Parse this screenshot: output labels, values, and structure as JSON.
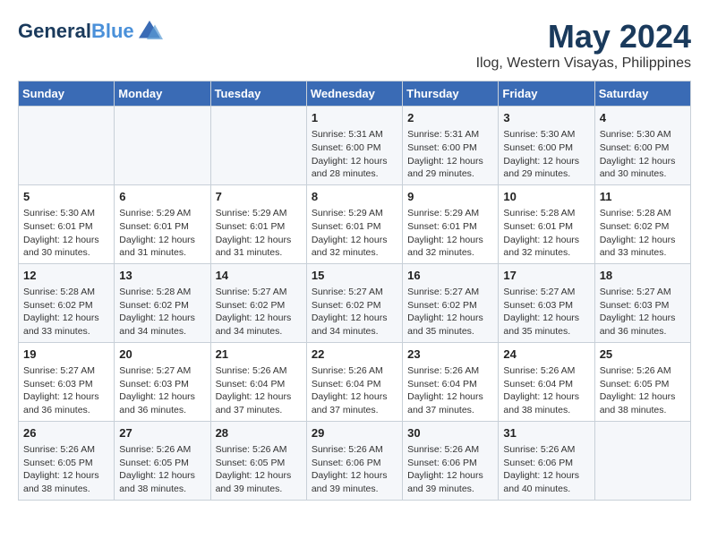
{
  "header": {
    "logo_line1": "General",
    "logo_line2": "Blue",
    "title": "May 2024",
    "subtitle": "Ilog, Western Visayas, Philippines"
  },
  "calendar": {
    "days_of_week": [
      "Sunday",
      "Monday",
      "Tuesday",
      "Wednesday",
      "Thursday",
      "Friday",
      "Saturday"
    ],
    "weeks": [
      [
        {
          "day": "",
          "info": ""
        },
        {
          "day": "",
          "info": ""
        },
        {
          "day": "",
          "info": ""
        },
        {
          "day": "1",
          "info": "Sunrise: 5:31 AM\nSunset: 6:00 PM\nDaylight: 12 hours\nand 28 minutes."
        },
        {
          "day": "2",
          "info": "Sunrise: 5:31 AM\nSunset: 6:00 PM\nDaylight: 12 hours\nand 29 minutes."
        },
        {
          "day": "3",
          "info": "Sunrise: 5:30 AM\nSunset: 6:00 PM\nDaylight: 12 hours\nand 29 minutes."
        },
        {
          "day": "4",
          "info": "Sunrise: 5:30 AM\nSunset: 6:00 PM\nDaylight: 12 hours\nand 30 minutes."
        }
      ],
      [
        {
          "day": "5",
          "info": "Sunrise: 5:30 AM\nSunset: 6:01 PM\nDaylight: 12 hours\nand 30 minutes."
        },
        {
          "day": "6",
          "info": "Sunrise: 5:29 AM\nSunset: 6:01 PM\nDaylight: 12 hours\nand 31 minutes."
        },
        {
          "day": "7",
          "info": "Sunrise: 5:29 AM\nSunset: 6:01 PM\nDaylight: 12 hours\nand 31 minutes."
        },
        {
          "day": "8",
          "info": "Sunrise: 5:29 AM\nSunset: 6:01 PM\nDaylight: 12 hours\nand 32 minutes."
        },
        {
          "day": "9",
          "info": "Sunrise: 5:29 AM\nSunset: 6:01 PM\nDaylight: 12 hours\nand 32 minutes."
        },
        {
          "day": "10",
          "info": "Sunrise: 5:28 AM\nSunset: 6:01 PM\nDaylight: 12 hours\nand 32 minutes."
        },
        {
          "day": "11",
          "info": "Sunrise: 5:28 AM\nSunset: 6:02 PM\nDaylight: 12 hours\nand 33 minutes."
        }
      ],
      [
        {
          "day": "12",
          "info": "Sunrise: 5:28 AM\nSunset: 6:02 PM\nDaylight: 12 hours\nand 33 minutes."
        },
        {
          "day": "13",
          "info": "Sunrise: 5:28 AM\nSunset: 6:02 PM\nDaylight: 12 hours\nand 34 minutes."
        },
        {
          "day": "14",
          "info": "Sunrise: 5:27 AM\nSunset: 6:02 PM\nDaylight: 12 hours\nand 34 minutes."
        },
        {
          "day": "15",
          "info": "Sunrise: 5:27 AM\nSunset: 6:02 PM\nDaylight: 12 hours\nand 34 minutes."
        },
        {
          "day": "16",
          "info": "Sunrise: 5:27 AM\nSunset: 6:02 PM\nDaylight: 12 hours\nand 35 minutes."
        },
        {
          "day": "17",
          "info": "Sunrise: 5:27 AM\nSunset: 6:03 PM\nDaylight: 12 hours\nand 35 minutes."
        },
        {
          "day": "18",
          "info": "Sunrise: 5:27 AM\nSunset: 6:03 PM\nDaylight: 12 hours\nand 36 minutes."
        }
      ],
      [
        {
          "day": "19",
          "info": "Sunrise: 5:27 AM\nSunset: 6:03 PM\nDaylight: 12 hours\nand 36 minutes."
        },
        {
          "day": "20",
          "info": "Sunrise: 5:27 AM\nSunset: 6:03 PM\nDaylight: 12 hours\nand 36 minutes."
        },
        {
          "day": "21",
          "info": "Sunrise: 5:26 AM\nSunset: 6:04 PM\nDaylight: 12 hours\nand 37 minutes."
        },
        {
          "day": "22",
          "info": "Sunrise: 5:26 AM\nSunset: 6:04 PM\nDaylight: 12 hours\nand 37 minutes."
        },
        {
          "day": "23",
          "info": "Sunrise: 5:26 AM\nSunset: 6:04 PM\nDaylight: 12 hours\nand 37 minutes."
        },
        {
          "day": "24",
          "info": "Sunrise: 5:26 AM\nSunset: 6:04 PM\nDaylight: 12 hours\nand 38 minutes."
        },
        {
          "day": "25",
          "info": "Sunrise: 5:26 AM\nSunset: 6:05 PM\nDaylight: 12 hours\nand 38 minutes."
        }
      ],
      [
        {
          "day": "26",
          "info": "Sunrise: 5:26 AM\nSunset: 6:05 PM\nDaylight: 12 hours\nand 38 minutes."
        },
        {
          "day": "27",
          "info": "Sunrise: 5:26 AM\nSunset: 6:05 PM\nDaylight: 12 hours\nand 38 minutes."
        },
        {
          "day": "28",
          "info": "Sunrise: 5:26 AM\nSunset: 6:05 PM\nDaylight: 12 hours\nand 39 minutes."
        },
        {
          "day": "29",
          "info": "Sunrise: 5:26 AM\nSunset: 6:06 PM\nDaylight: 12 hours\nand 39 minutes."
        },
        {
          "day": "30",
          "info": "Sunrise: 5:26 AM\nSunset: 6:06 PM\nDaylight: 12 hours\nand 39 minutes."
        },
        {
          "day": "31",
          "info": "Sunrise: 5:26 AM\nSunset: 6:06 PM\nDaylight: 12 hours\nand 40 minutes."
        },
        {
          "day": "",
          "info": ""
        }
      ]
    ]
  }
}
